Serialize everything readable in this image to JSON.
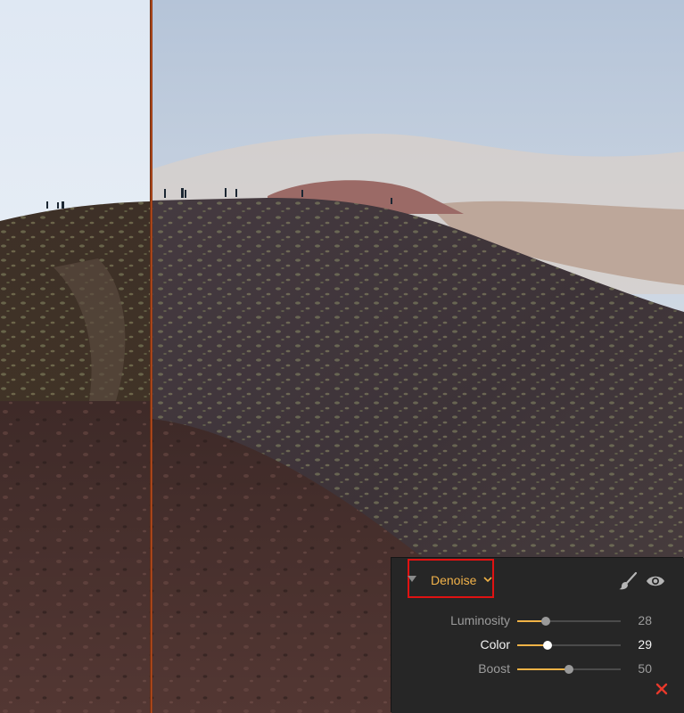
{
  "panel": {
    "title": "Denoise",
    "colors": {
      "accent": "#f0b246",
      "highlight_border": "#e01212",
      "reset": "#e8392b"
    },
    "icons": {
      "collapse": "triangle-down-icon",
      "dropdown": "chevron-down-icon",
      "brush": "brush-icon",
      "visibility": "eye-icon",
      "reset": "close-x-icon"
    },
    "sliders": [
      {
        "label": "Luminosity",
        "value": "28",
        "level": 28,
        "active": false
      },
      {
        "label": "Color",
        "value": "29",
        "level": 29,
        "active": true
      },
      {
        "label": "Boost",
        "value": "50",
        "level": 50,
        "active": false
      }
    ]
  }
}
